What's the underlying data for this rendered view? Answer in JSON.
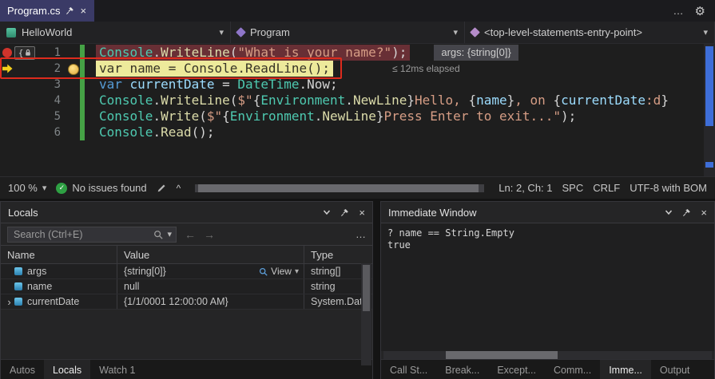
{
  "icons": {
    "settings": "⚙",
    "more": "…",
    "close": "×",
    "dropdown": "▾",
    "back": "←",
    "forward": "→",
    "check": "✓",
    "caret": "^",
    "expand": "›"
  },
  "colors": {
    "active_tab": "#3a3a66",
    "breakpoint_red": "#d0342c",
    "current_statement_yellow": "#edea9b",
    "breakpoint_line_bg": "#682f35",
    "change_bar_green": "#45a245",
    "issues_green": "#2ea043",
    "annotation_red": "#dd2b1d",
    "scrollbar_blue": "#3e6ed8"
  },
  "chrome": {
    "tab_title": "Program.cs",
    "navbar": {
      "project": "HelloWorld",
      "type": "Program",
      "member": "<top-level-statements-entry-point>"
    }
  },
  "editor": {
    "lines": [
      {
        "num": "1",
        "glyph": "breakpoint",
        "lockbox": true,
        "highlight": "red",
        "segments": [
          [
            "Console",
            "c"
          ],
          [
            ".",
            "p"
          ],
          [
            "WriteLine",
            "m"
          ],
          [
            "(",
            "p"
          ],
          [
            "\"What is your name?\"",
            "s"
          ],
          [
            ");",
            "p"
          ]
        ],
        "tip": {
          "style": "box",
          "text": "args: {string[0]}"
        }
      },
      {
        "num": "2",
        "glyph": "arrow",
        "highlight": "yellow",
        "segments": [
          [
            "var name = Console.ReadLine();",
            "d"
          ]
        ],
        "tip": {
          "style": "plain",
          "text": "≤ 12ms elapsed"
        }
      },
      {
        "num": "3",
        "segments": [
          [
            "var",
            "k"
          ],
          [
            " ",
            "p"
          ],
          [
            "currentDate",
            "v"
          ],
          [
            " = ",
            "p"
          ],
          [
            "DateTime",
            "c"
          ],
          [
            ".",
            "p"
          ],
          [
            "Now",
            "p"
          ],
          [
            ";",
            "p"
          ]
        ]
      },
      {
        "num": "4",
        "segments": [
          [
            "Console",
            "c"
          ],
          [
            ".",
            "p"
          ],
          [
            "WriteLine",
            "m"
          ],
          [
            "(",
            "p"
          ],
          [
            "$\"",
            "s"
          ],
          [
            "{",
            "p"
          ],
          [
            "Environment",
            "c"
          ],
          [
            ".",
            "p"
          ],
          [
            "NewLine",
            "m"
          ],
          [
            "}",
            "p"
          ],
          [
            "Hello, ",
            "s"
          ],
          [
            "{",
            "p"
          ],
          [
            "name",
            "v"
          ],
          [
            "}",
            "p"
          ],
          [
            ", on ",
            "s"
          ],
          [
            "{",
            "p"
          ],
          [
            "currentDate",
            "v"
          ],
          [
            ":d",
            "s"
          ],
          [
            "}",
            "p"
          ]
        ]
      },
      {
        "num": "5",
        "segments": [
          [
            "Console",
            "c"
          ],
          [
            ".",
            "p"
          ],
          [
            "Write",
            "m"
          ],
          [
            "(",
            "p"
          ],
          [
            "$\"",
            "s"
          ],
          [
            "{",
            "p"
          ],
          [
            "Environment",
            "c"
          ],
          [
            ".",
            "p"
          ],
          [
            "NewLine",
            "m"
          ],
          [
            "}",
            "p"
          ],
          [
            "Press Enter to exit...\"",
            "s"
          ],
          [
            ");",
            "p"
          ]
        ]
      },
      {
        "num": "6",
        "segments": [
          [
            "Console",
            "c"
          ],
          [
            ".",
            "p"
          ],
          [
            "Read",
            "m"
          ],
          [
            "();",
            "p"
          ]
        ]
      }
    ],
    "status": {
      "zoom": "100 %",
      "issues": "No issues found",
      "caret": "^",
      "line_col": "Ln: 2, Ch: 1",
      "spc": "SPC",
      "eol": "CRLF",
      "encoding": "UTF-8 with BOM"
    }
  },
  "locals": {
    "title": "Locals",
    "search_placeholder": "Search (Ctrl+E)",
    "columns": [
      "Name",
      "Value",
      "Type"
    ],
    "rows": [
      {
        "name": "args",
        "value": "{string[0]}",
        "type": "string[]",
        "view": "View",
        "expandable": false
      },
      {
        "name": "name",
        "value": "null",
        "type": "string",
        "expandable": false
      },
      {
        "name": "currentDate",
        "value": "{1/1/0001 12:00:00 AM}",
        "type": "System.Dat...",
        "expandable": true
      }
    ],
    "tabs": [
      "Autos",
      "Locals",
      "Watch 1"
    ],
    "active_tab": "Locals"
  },
  "immediate": {
    "title": "Immediate Window",
    "lines": [
      "? name == String.Empty",
      "true"
    ],
    "tabs": [
      "Call St...",
      "Break...",
      "Except...",
      "Comm...",
      "Imme...",
      "Output"
    ],
    "active_tab": "Imme..."
  }
}
